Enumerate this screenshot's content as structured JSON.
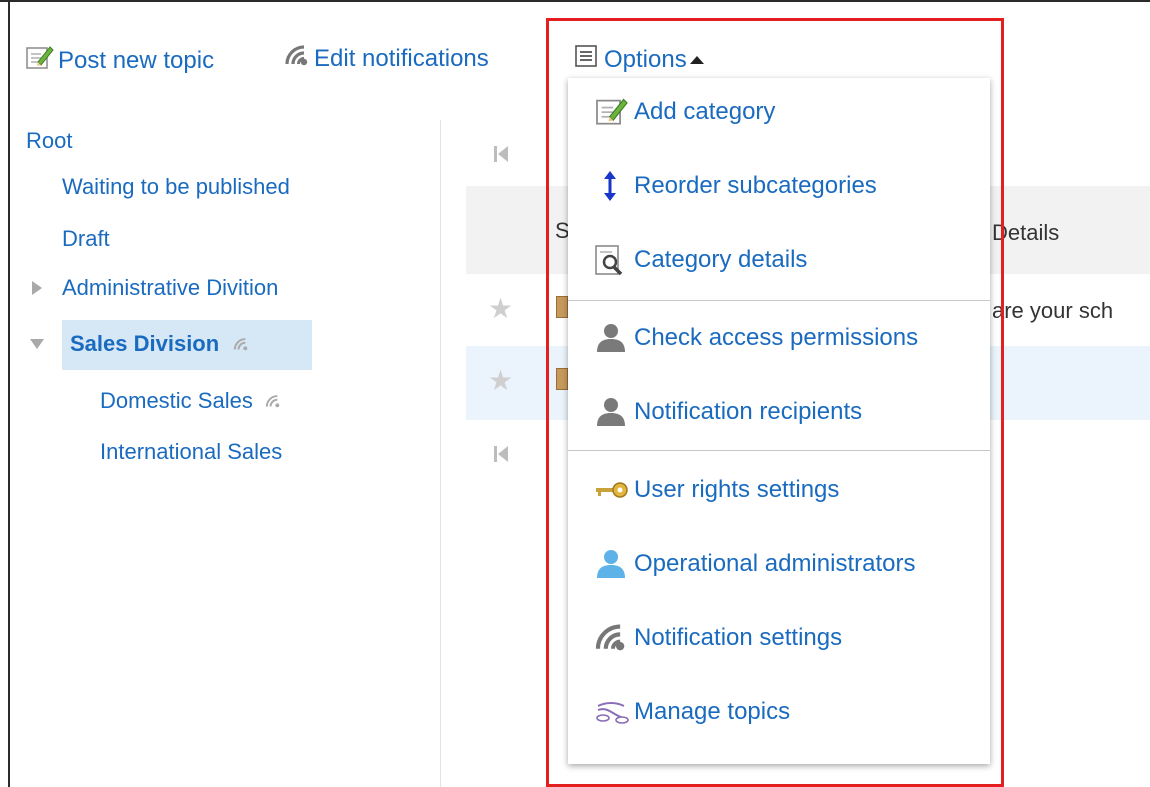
{
  "toolbar": {
    "post_new_topic": "Post new topic",
    "edit_notifications": "Edit notifications",
    "options": "Options"
  },
  "tree": {
    "root": "Root",
    "waiting": "Waiting to be published",
    "draft": "Draft",
    "admin_division": "Administrative Divition",
    "sales_division": "Sales Division",
    "domestic_sales": "Domestic Sales",
    "international_sales": "International Sales"
  },
  "content": {
    "header_left": "S",
    "header_right": "Details",
    "row1_text": "are your sch"
  },
  "options_menu": {
    "items": [
      {
        "label": "Add category",
        "icon": "edit-note-icon"
      },
      {
        "label": "Reorder subcategories",
        "icon": "reorder-arrows-icon"
      },
      {
        "label": "Category details",
        "icon": "details-magnifier-icon"
      },
      {
        "label": "Check access permissions",
        "icon": "user-icon"
      },
      {
        "label": "Notification recipients",
        "icon": "user-icon"
      },
      {
        "label": "User rights settings",
        "icon": "key-icon"
      },
      {
        "label": "Operational administrators",
        "icon": "admin-user-icon"
      },
      {
        "label": "Notification settings",
        "icon": "notification-icon"
      },
      {
        "label": "Manage topics",
        "icon": "manage-topics-icon"
      }
    ]
  },
  "colors": {
    "link": "#1a6bbf",
    "highlight_border": "#e41f1f",
    "selected_bg": "#d6e7f6"
  }
}
